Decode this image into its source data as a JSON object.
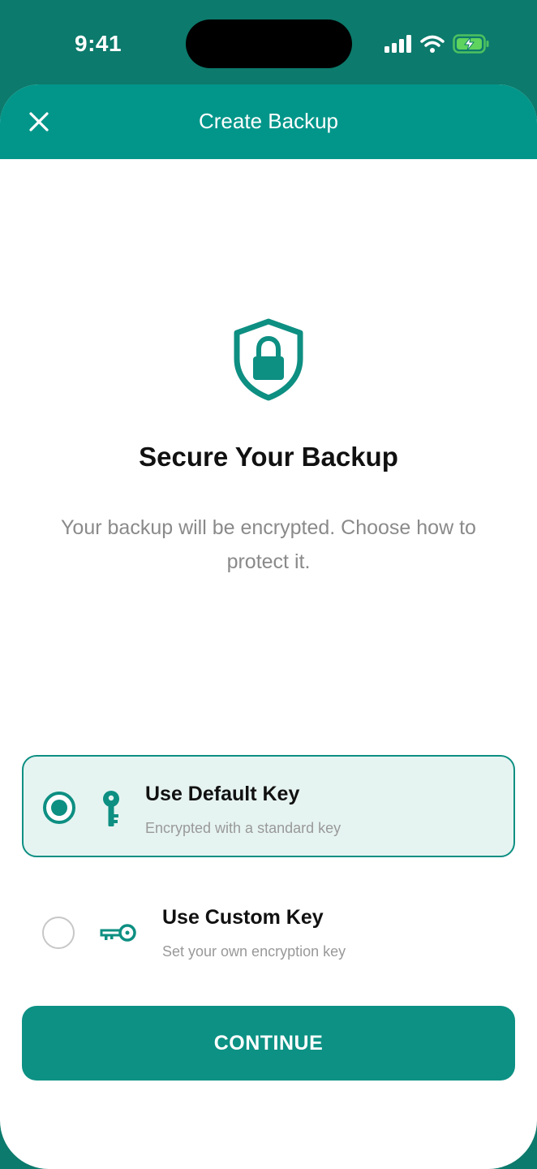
{
  "status_bar": {
    "time": "9:41",
    "icons": [
      "cellular-signal-icon",
      "wifi-icon",
      "battery-charging-icon"
    ]
  },
  "nav": {
    "title": "Create Backup",
    "close_icon": "close-icon"
  },
  "hero": {
    "icon": "shield-lock-icon",
    "title": "Secure Your Backup",
    "subtitle": "Your backup will be encrypted. Choose how to protect it."
  },
  "options": [
    {
      "title": "Use Default Key",
      "subtitle": "Encrypted with a standard key",
      "icon": "key-icon",
      "selected": true
    },
    {
      "title": "Use Custom Key",
      "subtitle": "Set your own encryption key",
      "icon": "custom-key-icon",
      "selected": false
    }
  ],
  "actions": {
    "continue_label": "CONTINUE"
  },
  "colors": {
    "header": "#0c7a6c",
    "accent": "#02968a",
    "selected_bg": "#e6f4f1",
    "battery": "#5ed35e"
  }
}
